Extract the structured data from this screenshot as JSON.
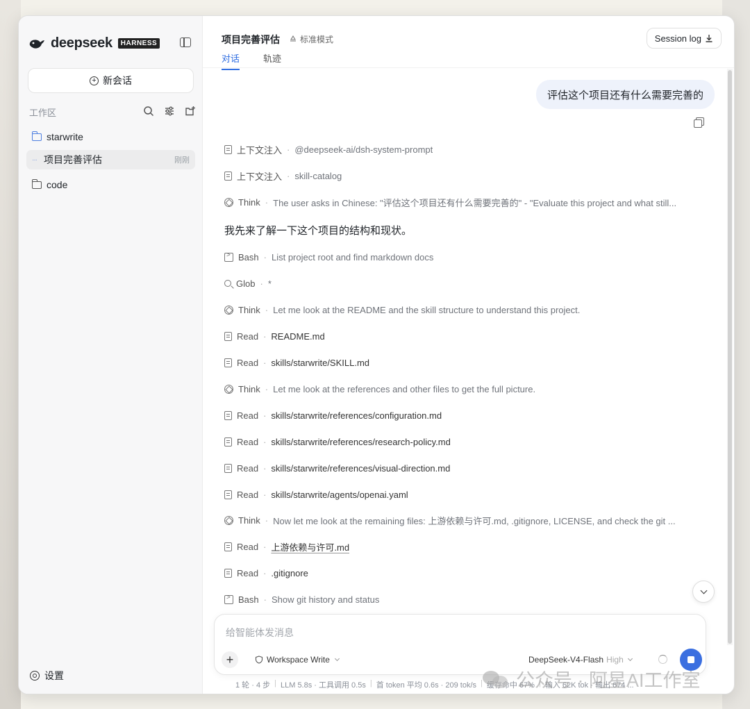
{
  "sidebar": {
    "logo_text": "deepseek",
    "badge": "HARNESS",
    "new_chat_label": "新会话",
    "workspace_title": "工作区",
    "items": [
      {
        "label": "starwrite",
        "icon": "folder-icon"
      },
      {
        "label": "项目完善评估",
        "meta": "刚刚",
        "icon": "session-icon"
      },
      {
        "label": "code",
        "icon": "folder-icon"
      }
    ],
    "settings_label": "设置"
  },
  "header": {
    "title": "项目完善评估",
    "mode": "标准模式",
    "tabs": [
      {
        "label": "对话"
      },
      {
        "label": "轨迹"
      }
    ],
    "session_log_label": "Session log"
  },
  "conversation": {
    "user_message": "评估这个项目还有什么需要完善的",
    "assistant_text": "我先来了解一下这个项目的结构和现状。",
    "steps": [
      {
        "icon": "document-icon",
        "kind": "上下文注入",
        "detail": "@deepseek-ai/dsh-system-prompt"
      },
      {
        "icon": "document-icon",
        "kind": "上下文注入",
        "detail": "skill-catalog"
      },
      {
        "icon": "think-icon",
        "kind": "Think",
        "detail": "The user asks in Chinese: \"评估这个项目还有什么需要完善的\" - \"Evaluate this project and what still..."
      },
      {
        "icon": "terminal-icon",
        "kind": "Bash",
        "detail": "List project root and find markdown docs"
      },
      {
        "icon": "search-icon",
        "kind": "Glob",
        "detail": "*"
      },
      {
        "icon": "think-icon",
        "kind": "Think",
        "detail": "Let me look at the README and the skill structure to understand this project."
      },
      {
        "icon": "document-icon",
        "kind": "Read",
        "detail": "README.md"
      },
      {
        "icon": "document-icon",
        "kind": "Read",
        "detail": "skills/starwrite/SKILL.md"
      },
      {
        "icon": "think-icon",
        "kind": "Think",
        "detail": "Let me look at the references and other files to get the full picture."
      },
      {
        "icon": "document-icon",
        "kind": "Read",
        "detail": "skills/starwrite/references/configuration.md"
      },
      {
        "icon": "document-icon",
        "kind": "Read",
        "detail": "skills/starwrite/references/research-policy.md"
      },
      {
        "icon": "document-icon",
        "kind": "Read",
        "detail": "skills/starwrite/references/visual-direction.md"
      },
      {
        "icon": "document-icon",
        "kind": "Read",
        "detail": "skills/starwrite/agents/openai.yaml"
      },
      {
        "icon": "think-icon",
        "kind": "Think",
        "detail": "Now let me look at the remaining files: 上游依赖与许可.md, .gitignore, LICENSE, and check the git ..."
      },
      {
        "icon": "document-icon",
        "kind": "Read",
        "detail": "上游依赖与许可.md"
      },
      {
        "icon": "document-icon",
        "kind": "Read",
        "detail": ".gitignore"
      },
      {
        "icon": "terminal-icon",
        "kind": "Bash",
        "detail": "Show git history and status"
      }
    ]
  },
  "composer": {
    "placeholder": "给智能体发消息",
    "workspace_mode": "Workspace Write",
    "model": "DeepSeek-V4-Flash",
    "effort": "High"
  },
  "status_bar": [
    "1 轮 · 4 步",
    "LLM 5.8s · 工具调用 0.5s",
    "首 token 平均 0.6s · 209 tok/s",
    "缓存命中 67%",
    "输入 62K tok · 输出 674 ..."
  ],
  "watermark": "公众号 · 阿星AI工作室"
}
